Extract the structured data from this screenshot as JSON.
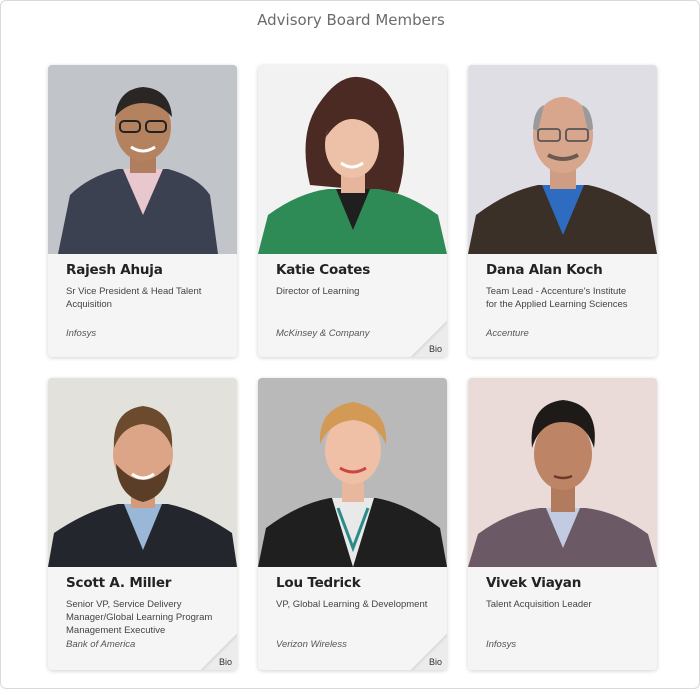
{
  "page": {
    "title": "Advisory Board Members"
  },
  "members": [
    {
      "name": "Rajesh Ahuja",
      "role": "Sr Vice President & Head Talent Acquisition",
      "company": "Infosys",
      "bio": ""
    },
    {
      "name": "Katie Coates",
      "role": "Director of Learning",
      "company": "McKinsey & Company",
      "bio": "Bio"
    },
    {
      "name": "Dana Alan Koch",
      "role": "Team Lead - Accenture's Institute for the Applied Learning Sciences",
      "company": "Accenture",
      "bio": ""
    },
    {
      "name": "Scott A. Miller",
      "role": "Senior VP, Service Delivery Manager/Global Learning Program Management Executive",
      "company": "Bank of America",
      "bio": "Bio"
    },
    {
      "name": "Lou Tedrick",
      "role": "VP, Global Learning & Development",
      "company": "Verizon Wireless",
      "bio": "Bio"
    },
    {
      "name": "Vivek Viayan",
      "role": "Talent Acquisition Leader",
      "company": "Infosys",
      "bio": ""
    }
  ]
}
